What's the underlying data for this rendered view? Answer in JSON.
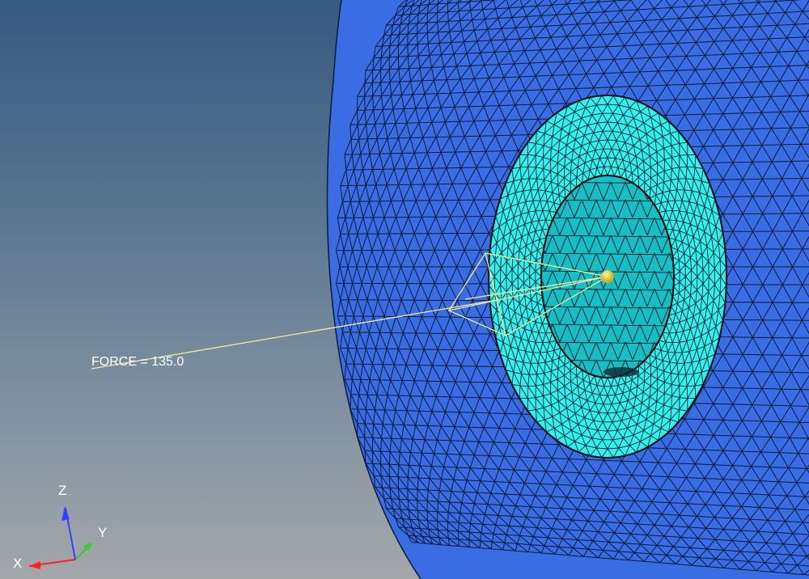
{
  "viewport": {
    "background_top": "#365a7f",
    "background_bottom": "#a4a7aa"
  },
  "model": {
    "outer_surface_color": "#3a6de3",
    "washer_color": "#33f0f0",
    "bore_color": "#16bfc6",
    "mesh_line_color": "#0a1a3a",
    "load_color": "#f2ea9a",
    "load_node_color": "#e8d020"
  },
  "load": {
    "label": "FORCE = 135.0"
  },
  "triad": {
    "x_label": "X",
    "y_label": "Y",
    "z_label": "Z",
    "x_color": "#ff2020",
    "y_color": "#30d030",
    "z_color": "#3040ff"
  }
}
